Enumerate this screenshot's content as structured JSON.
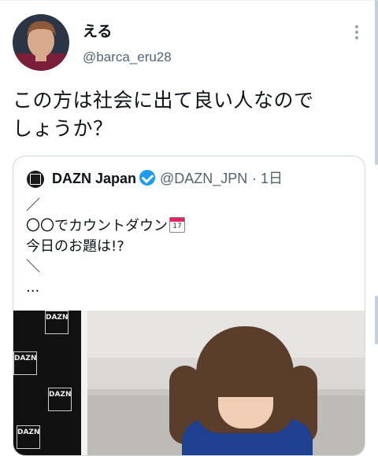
{
  "author": {
    "display_name": "える",
    "handle": "@barca_eru28"
  },
  "tweet": {
    "text_line1": "この方は社会に出て良い人なので",
    "text_line2": "しょうか？"
  },
  "quoted": {
    "display_name": "DAZN Japan",
    "handle": "@DAZN_JPN",
    "time": "· 1日",
    "lines": [
      "／",
      "〇〇でカウントダウン",
      "今日のお題は!?",
      "＼",
      "..."
    ],
    "calendar_emoji_text": "17",
    "video_brand": "DAZN"
  },
  "icons": {
    "more": "more-vertical-icon",
    "verified": "verified-badge-icon",
    "calendar": "calendar-icon"
  },
  "colors": {
    "verified": "#1d9bf0",
    "secondary_text": "#536471",
    "border": "#cfd9de"
  }
}
